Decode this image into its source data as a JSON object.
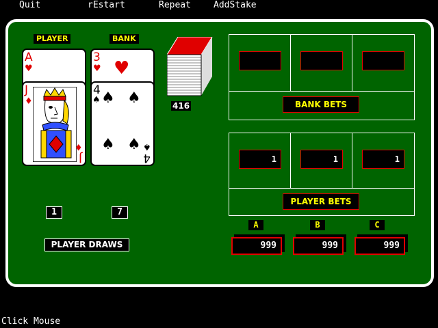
{
  "menu": {
    "quit": "Quit",
    "restart": "rEstart",
    "repeat": "Repeat",
    "add_stake": "AddStake"
  },
  "status_line": "Click Mouse",
  "hands": {
    "player": {
      "title": "PLAYER",
      "cards": [
        {
          "rank": "A",
          "suit": "♥"
        },
        {
          "rank": "J",
          "suit": "♦"
        }
      ],
      "total": "1"
    },
    "bank": {
      "title": "BANK",
      "cards": [
        {
          "rank": "3",
          "suit": "♥"
        },
        {
          "rank": "4",
          "suit": "♠"
        }
      ],
      "total": "7"
    }
  },
  "deck": {
    "count": "416"
  },
  "message": "PLAYER DRAWS",
  "bank_bets": {
    "label": "BANK BETS",
    "slots": [
      "",
      "",
      ""
    ]
  },
  "player_bets": {
    "label": "PLAYER BETS",
    "slots": [
      "1",
      "1",
      "1"
    ]
  },
  "stakes": [
    {
      "name": "A",
      "amount": "999"
    },
    {
      "name": "B",
      "amount": "999"
    },
    {
      "name": "C",
      "amount": "999"
    }
  ],
  "colors": {
    "felt": "#006400",
    "accent": "#ffff00",
    "border": "#e00000"
  }
}
